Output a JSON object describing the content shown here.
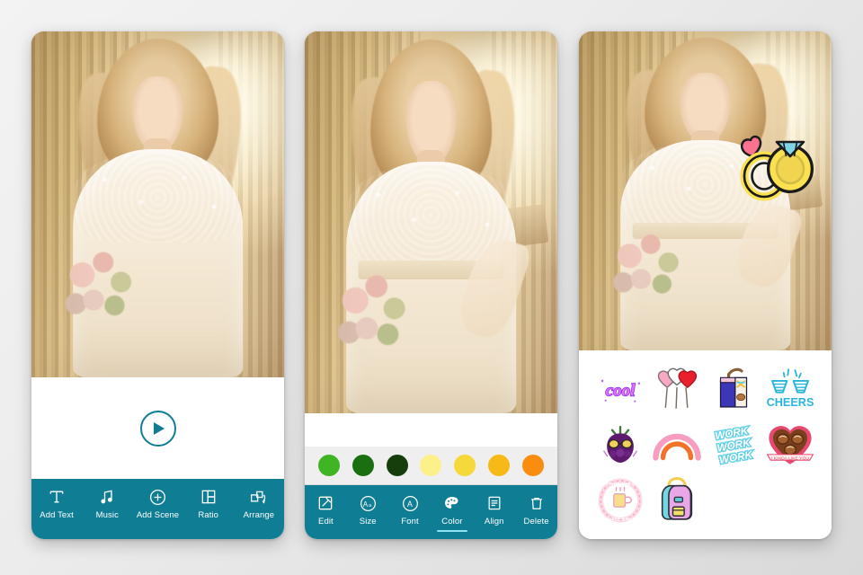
{
  "app": {
    "accent_teal": "#0f7d94",
    "underline_color": "#8fe3f2",
    "background": "#e8e8e8"
  },
  "panels": [
    {
      "id": "panel-1",
      "name": "video-editor-home",
      "photo_alt": "Bride in lace wedding dress holding bouquet",
      "play_button": "play-icon",
      "toolbar": {
        "items": [
          {
            "label": "Add Text",
            "icon": "text-icon",
            "active": false
          },
          {
            "label": "Music",
            "icon": "music-note-icon",
            "active": false
          },
          {
            "label": "Add Scene",
            "icon": "plus-circle-icon",
            "active": false
          },
          {
            "label": "Ratio",
            "icon": "ratio-grid-icon",
            "active": false
          },
          {
            "label": "Arrange",
            "icon": "arrange-icon",
            "active": false
          }
        ]
      }
    },
    {
      "id": "panel-2",
      "name": "text-color-editor",
      "photo_alt": "Bride in lace wedding dress by window railing",
      "swatches": [
        {
          "name": "green-light",
          "hex": "#3fb424"
        },
        {
          "name": "green-dark",
          "hex": "#1a6f10"
        },
        {
          "name": "green-darkest",
          "hex": "#153e0c"
        },
        {
          "name": "yellow-pale",
          "hex": "#fbf08a"
        },
        {
          "name": "yellow",
          "hex": "#f5d83a"
        },
        {
          "name": "amber",
          "hex": "#f7b918"
        },
        {
          "name": "orange",
          "hex": "#fa8c10"
        }
      ],
      "toolbar": {
        "items": [
          {
            "label": "Edit",
            "icon": "pencil-square-icon",
            "active": false
          },
          {
            "label": "Size",
            "icon": "size-aa-icon",
            "active": false
          },
          {
            "label": "Font",
            "icon": "font-a-icon",
            "active": false
          },
          {
            "label": "Color",
            "icon": "palette-icon",
            "active": true
          },
          {
            "label": "Align",
            "icon": "align-lines-icon",
            "active": false
          },
          {
            "label": "Delete",
            "icon": "trash-icon",
            "active": false
          }
        ]
      }
    },
    {
      "id": "panel-3",
      "name": "sticker-picker",
      "photo_alt": "Bride in lace wedding dress with wedding ring sticker applied",
      "applied_sticker": {
        "name": "wedding-rings-sticker",
        "label": "Wedding Rings"
      },
      "stickers": [
        {
          "name": "cool-text-sticker",
          "label": "cool"
        },
        {
          "name": "heart-balloons-sticker",
          "label": "Heart Balloons"
        },
        {
          "name": "juice-box-sticker",
          "label": "Juice Box"
        },
        {
          "name": "cheers-sticker",
          "label": "CHEERS"
        },
        {
          "name": "berry-sunglasses-sticker",
          "label": "Cool Berry"
        },
        {
          "name": "rainbow-sticker",
          "label": "Rainbow"
        },
        {
          "name": "work-work-work-sticker",
          "label": "WORK WORK WORK"
        },
        {
          "name": "chocolate-heart-box-sticker",
          "label": "Chocolate Box"
        },
        {
          "name": "coffee-break-sticker",
          "label": "COFFEE BREAK"
        },
        {
          "name": "backpack-sticker",
          "label": "Backpack"
        }
      ]
    }
  ]
}
